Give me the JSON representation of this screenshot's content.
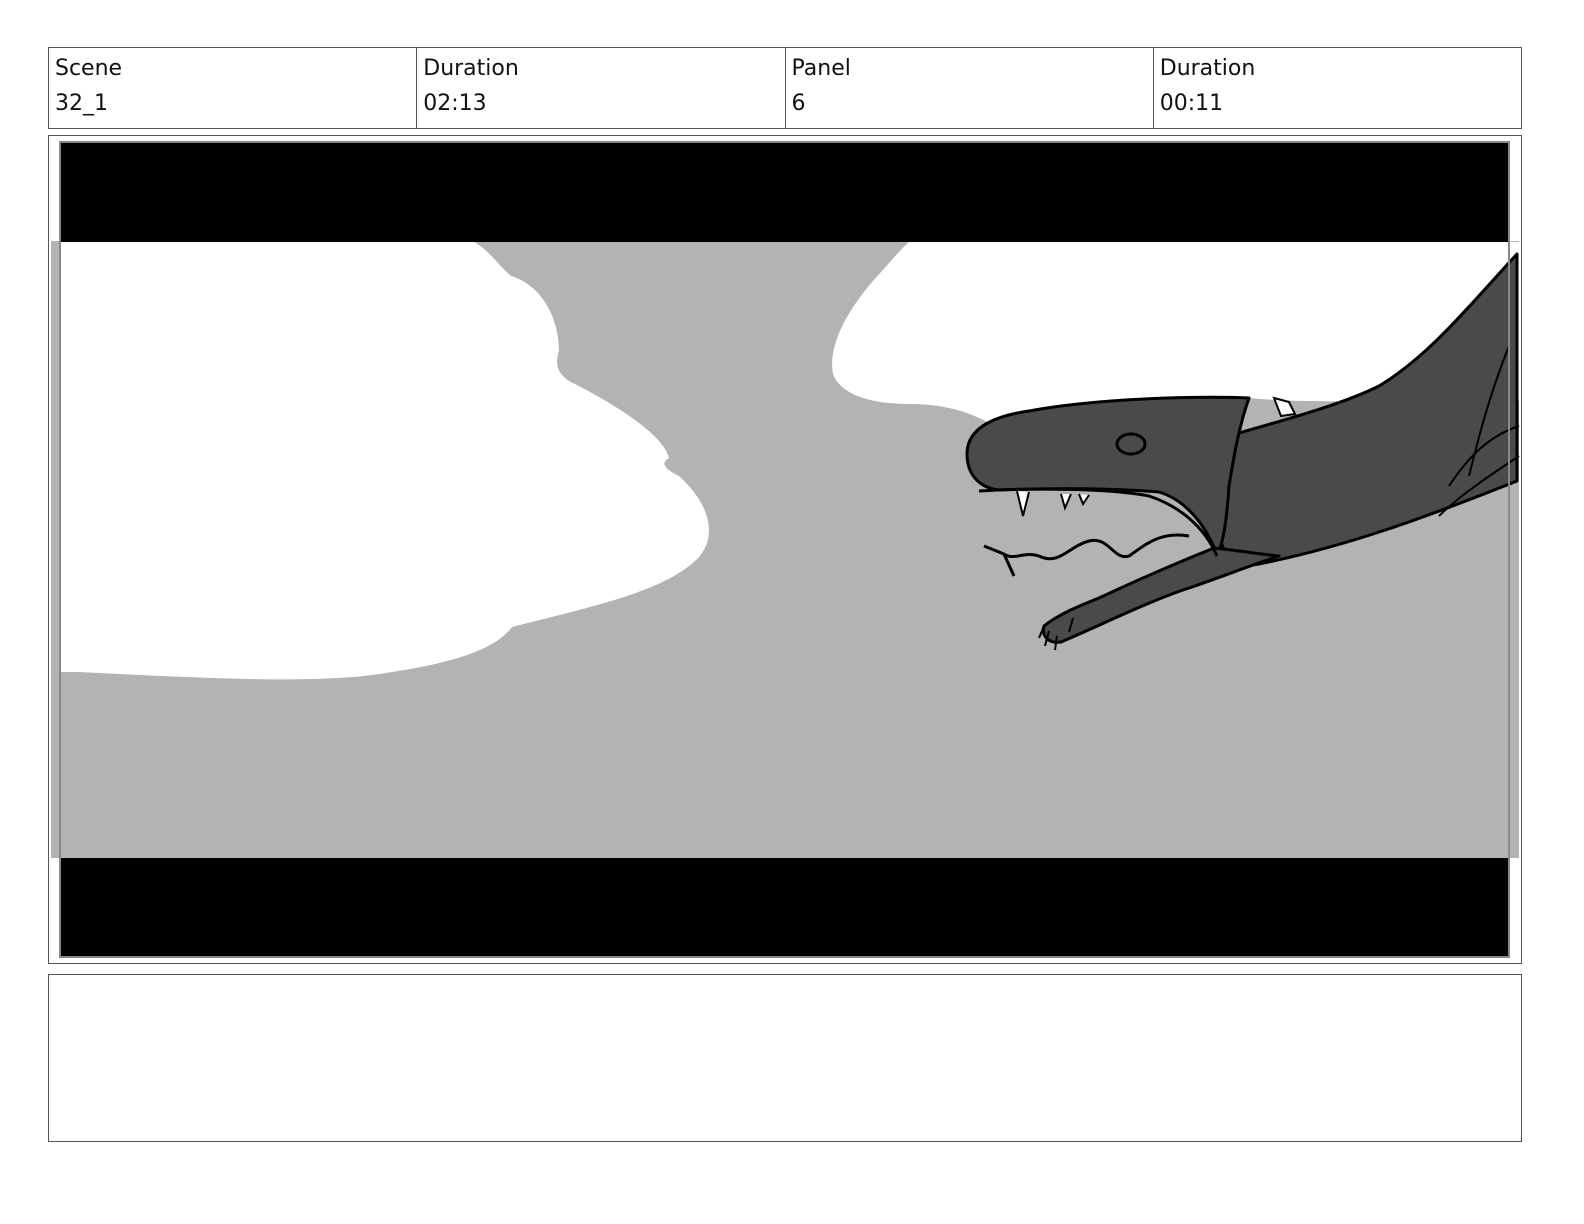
{
  "header": {
    "scene_label": "Scene",
    "scene_value": "32_1",
    "duration_label": "Duration",
    "duration_value": "02:13",
    "panel_label": "Panel",
    "panel_value": "6",
    "panel_duration_label": "Duration",
    "panel_duration_value": "00:11"
  },
  "colors": {
    "sky": "#b3b3b3",
    "cloud": "#ffffff",
    "creature": "#4a4a4a",
    "letterbox": "#000000",
    "border": "#555555"
  },
  "notes": {
    "text": ""
  }
}
